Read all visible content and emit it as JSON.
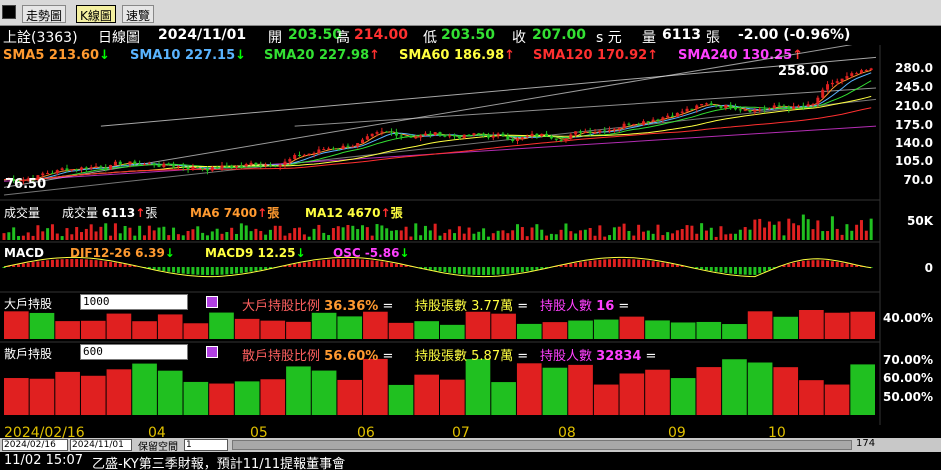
{
  "tabs": [
    {
      "label": "走勢圖"
    },
    {
      "label": "K線圖"
    },
    {
      "label": "速覽"
    }
  ],
  "header": {
    "stock": "上詮(3363)",
    "chart_kind": "日線圖",
    "date": "2024/11/01",
    "open_label": "開",
    "open": "203.50",
    "high_label": "高",
    "high": "214.00",
    "low_label": "低",
    "low": "203.50",
    "close_label": "收",
    "close": "207.00",
    "unit": "s 元",
    "vol_label": "量",
    "vol": "6113",
    "vol_unit": "張",
    "change": "-2.00 (-0.96%)"
  },
  "sma": [
    {
      "text": "SMA5 213.60",
      "arrow": "↓",
      "color": "#ff9a30",
      "arrow_color": "#00ff00"
    },
    {
      "text": "SMA10 227.15",
      "arrow": "↓",
      "color": "#5ab4ff",
      "arrow_color": "#00ff00"
    },
    {
      "text": "SMA20 227.98",
      "arrow": "↑",
      "color": "#33e033",
      "arrow_color": "#ff3030"
    },
    {
      "text": "SMA60 186.98",
      "arrow": "↑",
      "color": "#ffff40",
      "arrow_color": "#ff3030"
    },
    {
      "text": "SMA120 170.92",
      "arrow": "↑",
      "color": "#ff3030",
      "arrow_color": "#ff3030"
    },
    {
      "text": "SMA240 130.25",
      "arrow": "↑",
      "color": "#ff40ff",
      "arrow_color": "#ff3030"
    }
  ],
  "price_axis": [
    "280.0",
    "245.0",
    "210.0",
    "175.0",
    "140.0",
    "105.0",
    "70.0"
  ],
  "price_high_label": "258.00",
  "price_low_label": "76.50",
  "volume": {
    "title": "成交量",
    "v_label": "成交量",
    "v_value": "6113",
    "v_arrow": "↑",
    "v_unit": "張",
    "ma6": "MA6 7400",
    "ma6_arrow": "↑",
    "ma6_unit": "張",
    "ma12": "MA12 4670",
    "ma12_arrow": "↑",
    "ma12_unit": "張",
    "axis": "50K"
  },
  "macd": {
    "title": "MACD",
    "dif": "DIF12-26 6.39",
    "dif_arrow": "↓",
    "macd9": "MACD9 12.25",
    "macd9_arrow": "↓",
    "osc": "OSC -5.86",
    "osc_arrow": "↓",
    "axis": "0"
  },
  "big_holder": {
    "title": "大戶持股",
    "input": "1000",
    "ratio_label": "大戶持股比例",
    "ratio": "36.36%",
    "eq": "=",
    "shares_label": "持股張數",
    "shares": "3.77萬",
    "people_label": "持股人數",
    "people": "16",
    "axis": "40.00%"
  },
  "retail_holder": {
    "title": "散戶持股",
    "input": "600",
    "ratio_label": "散戶持股比例",
    "ratio": "56.60%",
    "eq": "=",
    "shares_label": "持股張數",
    "shares": "5.87萬",
    "people_label": "持股人數",
    "people": "32834",
    "axis": [
      "70.00%",
      "60.00%",
      "50.00%"
    ]
  },
  "x_axis": [
    "2024/02/16",
    "04",
    "05",
    "06",
    "07",
    "08",
    "09",
    "10"
  ],
  "controls": {
    "from": "2024/02/16",
    "to": "2024/11/01",
    "keep_label": "保留空間",
    "keep_value": "1",
    "count": "174"
  },
  "status": {
    "time": "11/02 15:07",
    "news": "乙盛-KY第三季財報，預計11/11提報董事會"
  },
  "colors": {
    "up": "#e02020",
    "down": "#20c020",
    "bg": "#000000"
  }
}
